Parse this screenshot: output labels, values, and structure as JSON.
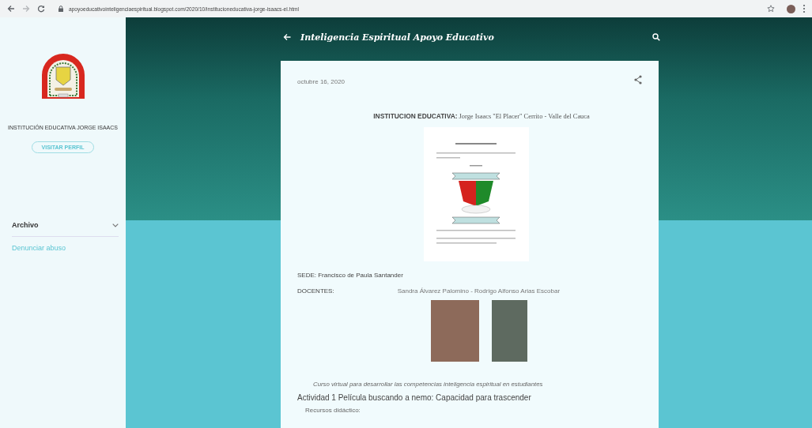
{
  "browser": {
    "url": "apoyoeducativointeligenciaespiritual.blogspot.com/2020/10/institucioneducativa-jorge-isaacs-el.html"
  },
  "sidebar": {
    "profile_name": "INSTITUCIÓN EDUCATIVA JORGE ISAACS",
    "profile_button": "VISITAR PERFIL",
    "archive_label": "Archivo",
    "links": [
      "Denunciar abuso"
    ]
  },
  "header": {
    "title": "Inteligencia Espiritual Apoyo Educativo"
  },
  "post": {
    "date": "octubre 16, 2020",
    "heading": "**INSTITUCION EDUCATIVA:** Jorge Isaacs \"El Placer\" Cerrito - Valle del Cauca",
    "sede": "SEDE: Francisco de Paula Santander",
    "docentes_label": "DOCENTES:",
    "docentes_names": "Sandra Álvarez Palomino  - Rodrigo Alfonso Arias Escobar",
    "caption": "Curso virtual para desarrollar las competencias inteligencia espiritual en estudiantes",
    "activity": "Actividad 1 Película buscando a nemo: Capacidad para trascender",
    "resources": "Recursos didáctico:"
  }
}
